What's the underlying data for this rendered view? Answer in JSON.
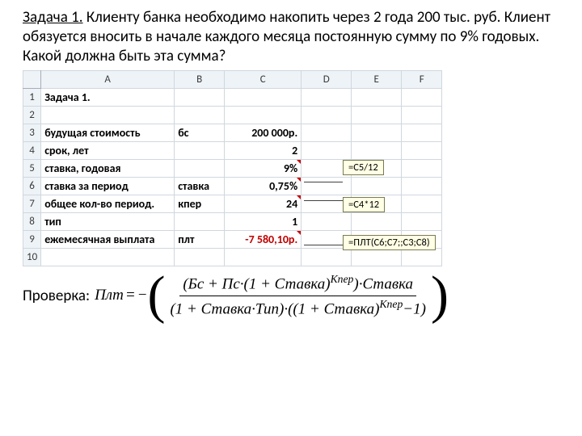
{
  "problem": {
    "label": "Задача 1.",
    "text": " Клиенту банка необходимо накопить  через 2 года 200 тыс. руб. Клиент обязуется вносить в начале каждого месяца постоянную сумму по 9% годовых. Какой должна быть эта сумма?"
  },
  "sheet": {
    "columns": [
      "A",
      "B",
      "C",
      "D",
      "E",
      "F"
    ],
    "rows": [
      {
        "n": "1",
        "A": "Задача 1.",
        "bold": true
      },
      {
        "n": "2",
        "A": ""
      },
      {
        "n": "3",
        "A": "будущая стоимость",
        "B": "бс",
        "C": "200 000р.",
        "bold": true
      },
      {
        "n": "4",
        "A": "срок, лет",
        "B": "",
        "C": "2",
        "bold": true
      },
      {
        "n": "5",
        "A": "ставка, годовая",
        "B": "",
        "C": "9%",
        "bold": true,
        "mark": true
      },
      {
        "n": "6",
        "A": "ставка за период",
        "B": "ставка",
        "C": "0,75%",
        "bold": true,
        "mark": true
      },
      {
        "n": "7",
        "A": "общее кол-во период.",
        "B": "кпер",
        "C": "24",
        "bold": true,
        "mark": true
      },
      {
        "n": "8",
        "A": "тип",
        "B": "",
        "C": "1",
        "bold": true
      },
      {
        "n": "9",
        "A": "ежемесячная выплата",
        "B": "плт",
        "C": "-7 580,10р.",
        "bold": true,
        "neg": true,
        "mark": true
      },
      {
        "n": "10",
        "A": ""
      }
    ]
  },
  "callouts": {
    "f1": "=C5/12",
    "f2": "=C4*12",
    "f3": "=ПЛТ(C6;C7;;C3;C8)"
  },
  "check_label": "Проверка:",
  "formula": {
    "lhs": "Плт",
    "minus": "−",
    "num_l": "(Бс + Пс·(1 + Ставка)",
    "num_exp": "Кпер",
    "num_r": ")·Ставка",
    "den_l": "(1 + Ставка·Тип)·((1 + Ставка)",
    "den_exp": "Кпер",
    "den_r": "−1)"
  }
}
